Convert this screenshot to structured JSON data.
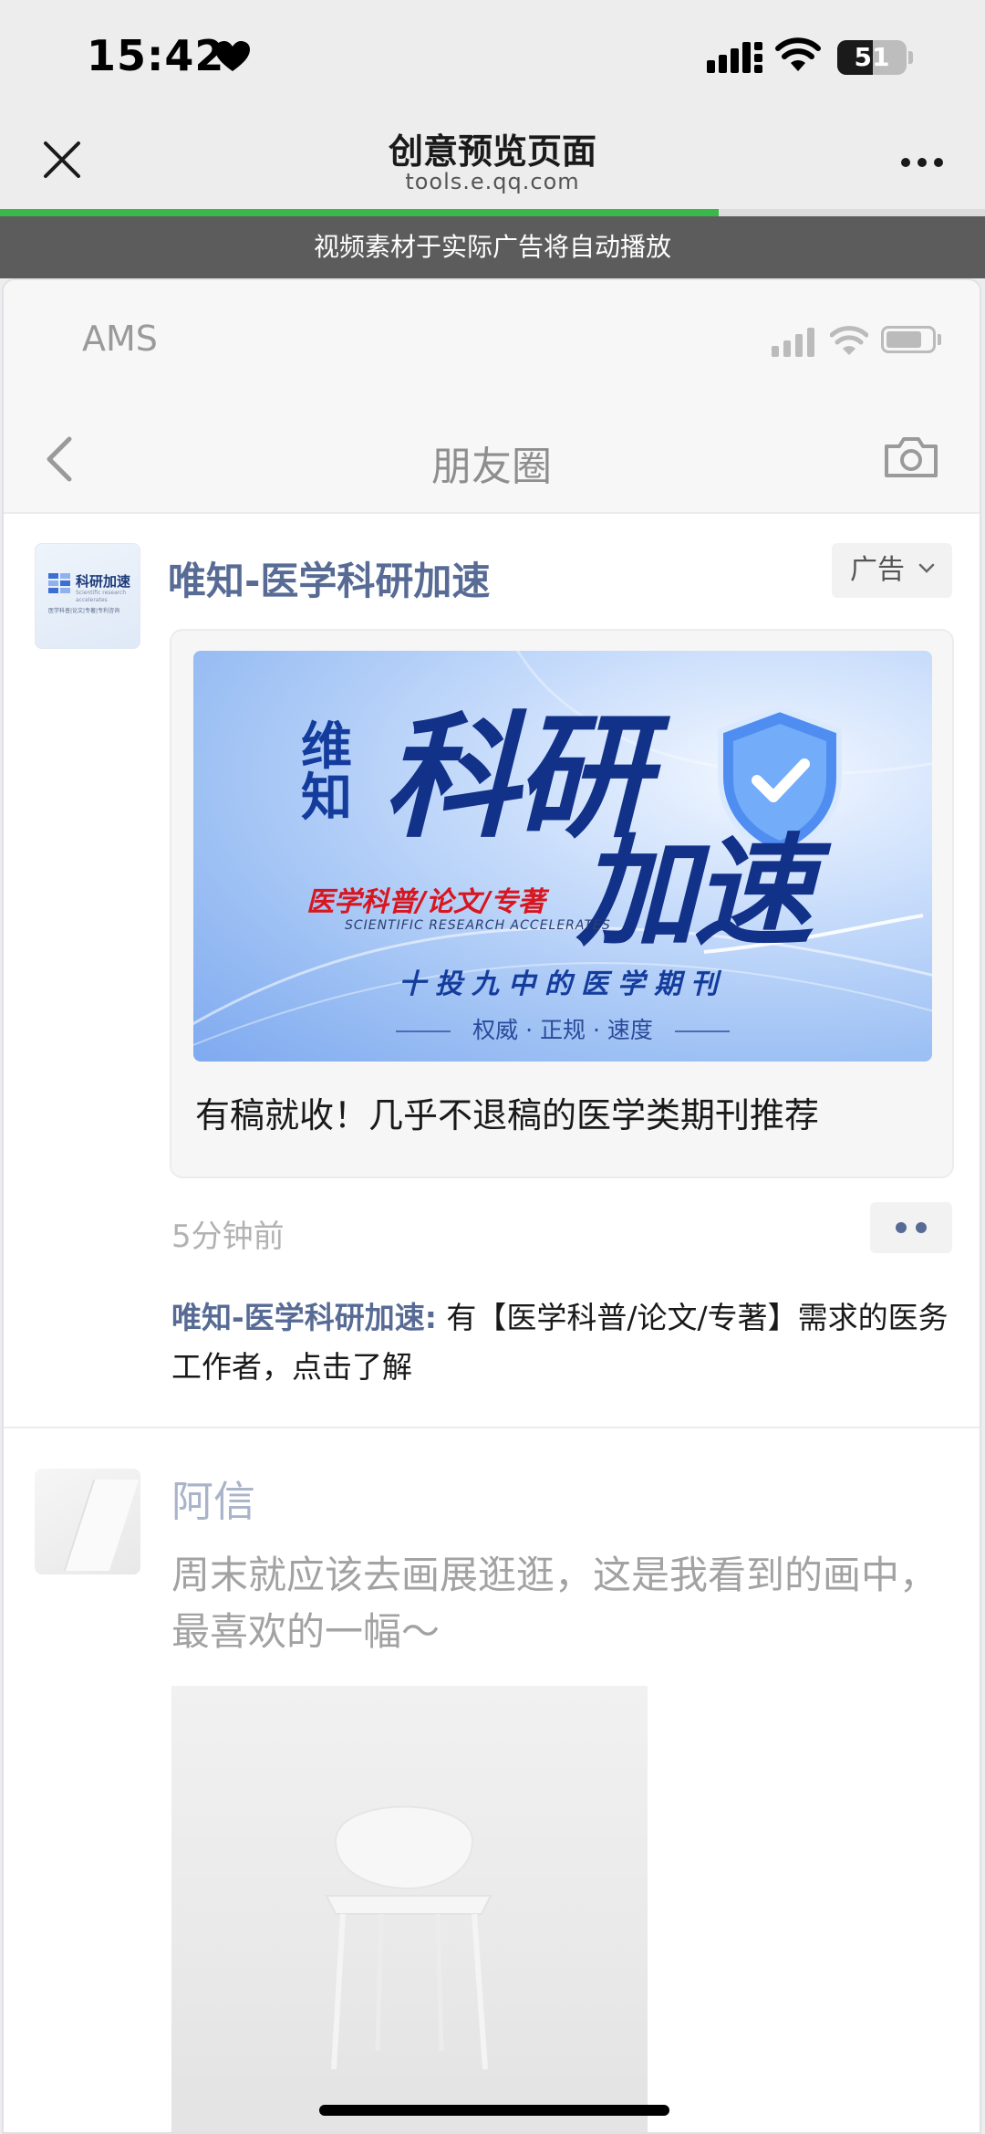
{
  "status_bar": {
    "time": "15:42",
    "battery": "51",
    "battery_level": 0.51
  },
  "browser": {
    "title": "创意预览页面",
    "url": "tools.e.qq.com",
    "load_progress": 0.73
  },
  "notice": "视频素材于实际广告将自动播放",
  "preview": {
    "carrier": "AMS",
    "page_title": "朋友圈",
    "ad_post": {
      "avatar_text": "科研加速",
      "avatar_en": "Scientific research accelerates",
      "avatar_tag": "医学科普|论文|专著|专利咨询",
      "name": "唯知-医学科研加速",
      "badge": "广告",
      "banner": {
        "brand_small": "维知",
        "brand_big_1": "科研",
        "brand_big_2": "加速",
        "red_line": "医学科普/论文/专著",
        "en_line": "SCIENTIFIC RESEARCH ACCELERATES",
        "mid_line": "十投九中的医学期刊",
        "bottom_line": "权威 · 正规 · 速度"
      },
      "headline": "有稿就收！几乎不退稿的医学类期刊推荐",
      "time": "5分钟前",
      "comment_author": "唯知-医学科研加速:",
      "comment_text": " 有【医学科普/论文/专著】需求的医务工作者，点击了解"
    },
    "next_post": {
      "name": "阿信",
      "text": "周末就应该去画展逛逛，这是我看到的画中，最喜欢的一幅～"
    }
  },
  "colors": {
    "link": "#576b95",
    "progress": "#3ab84a",
    "notice_bg": "#5c5c5c"
  }
}
